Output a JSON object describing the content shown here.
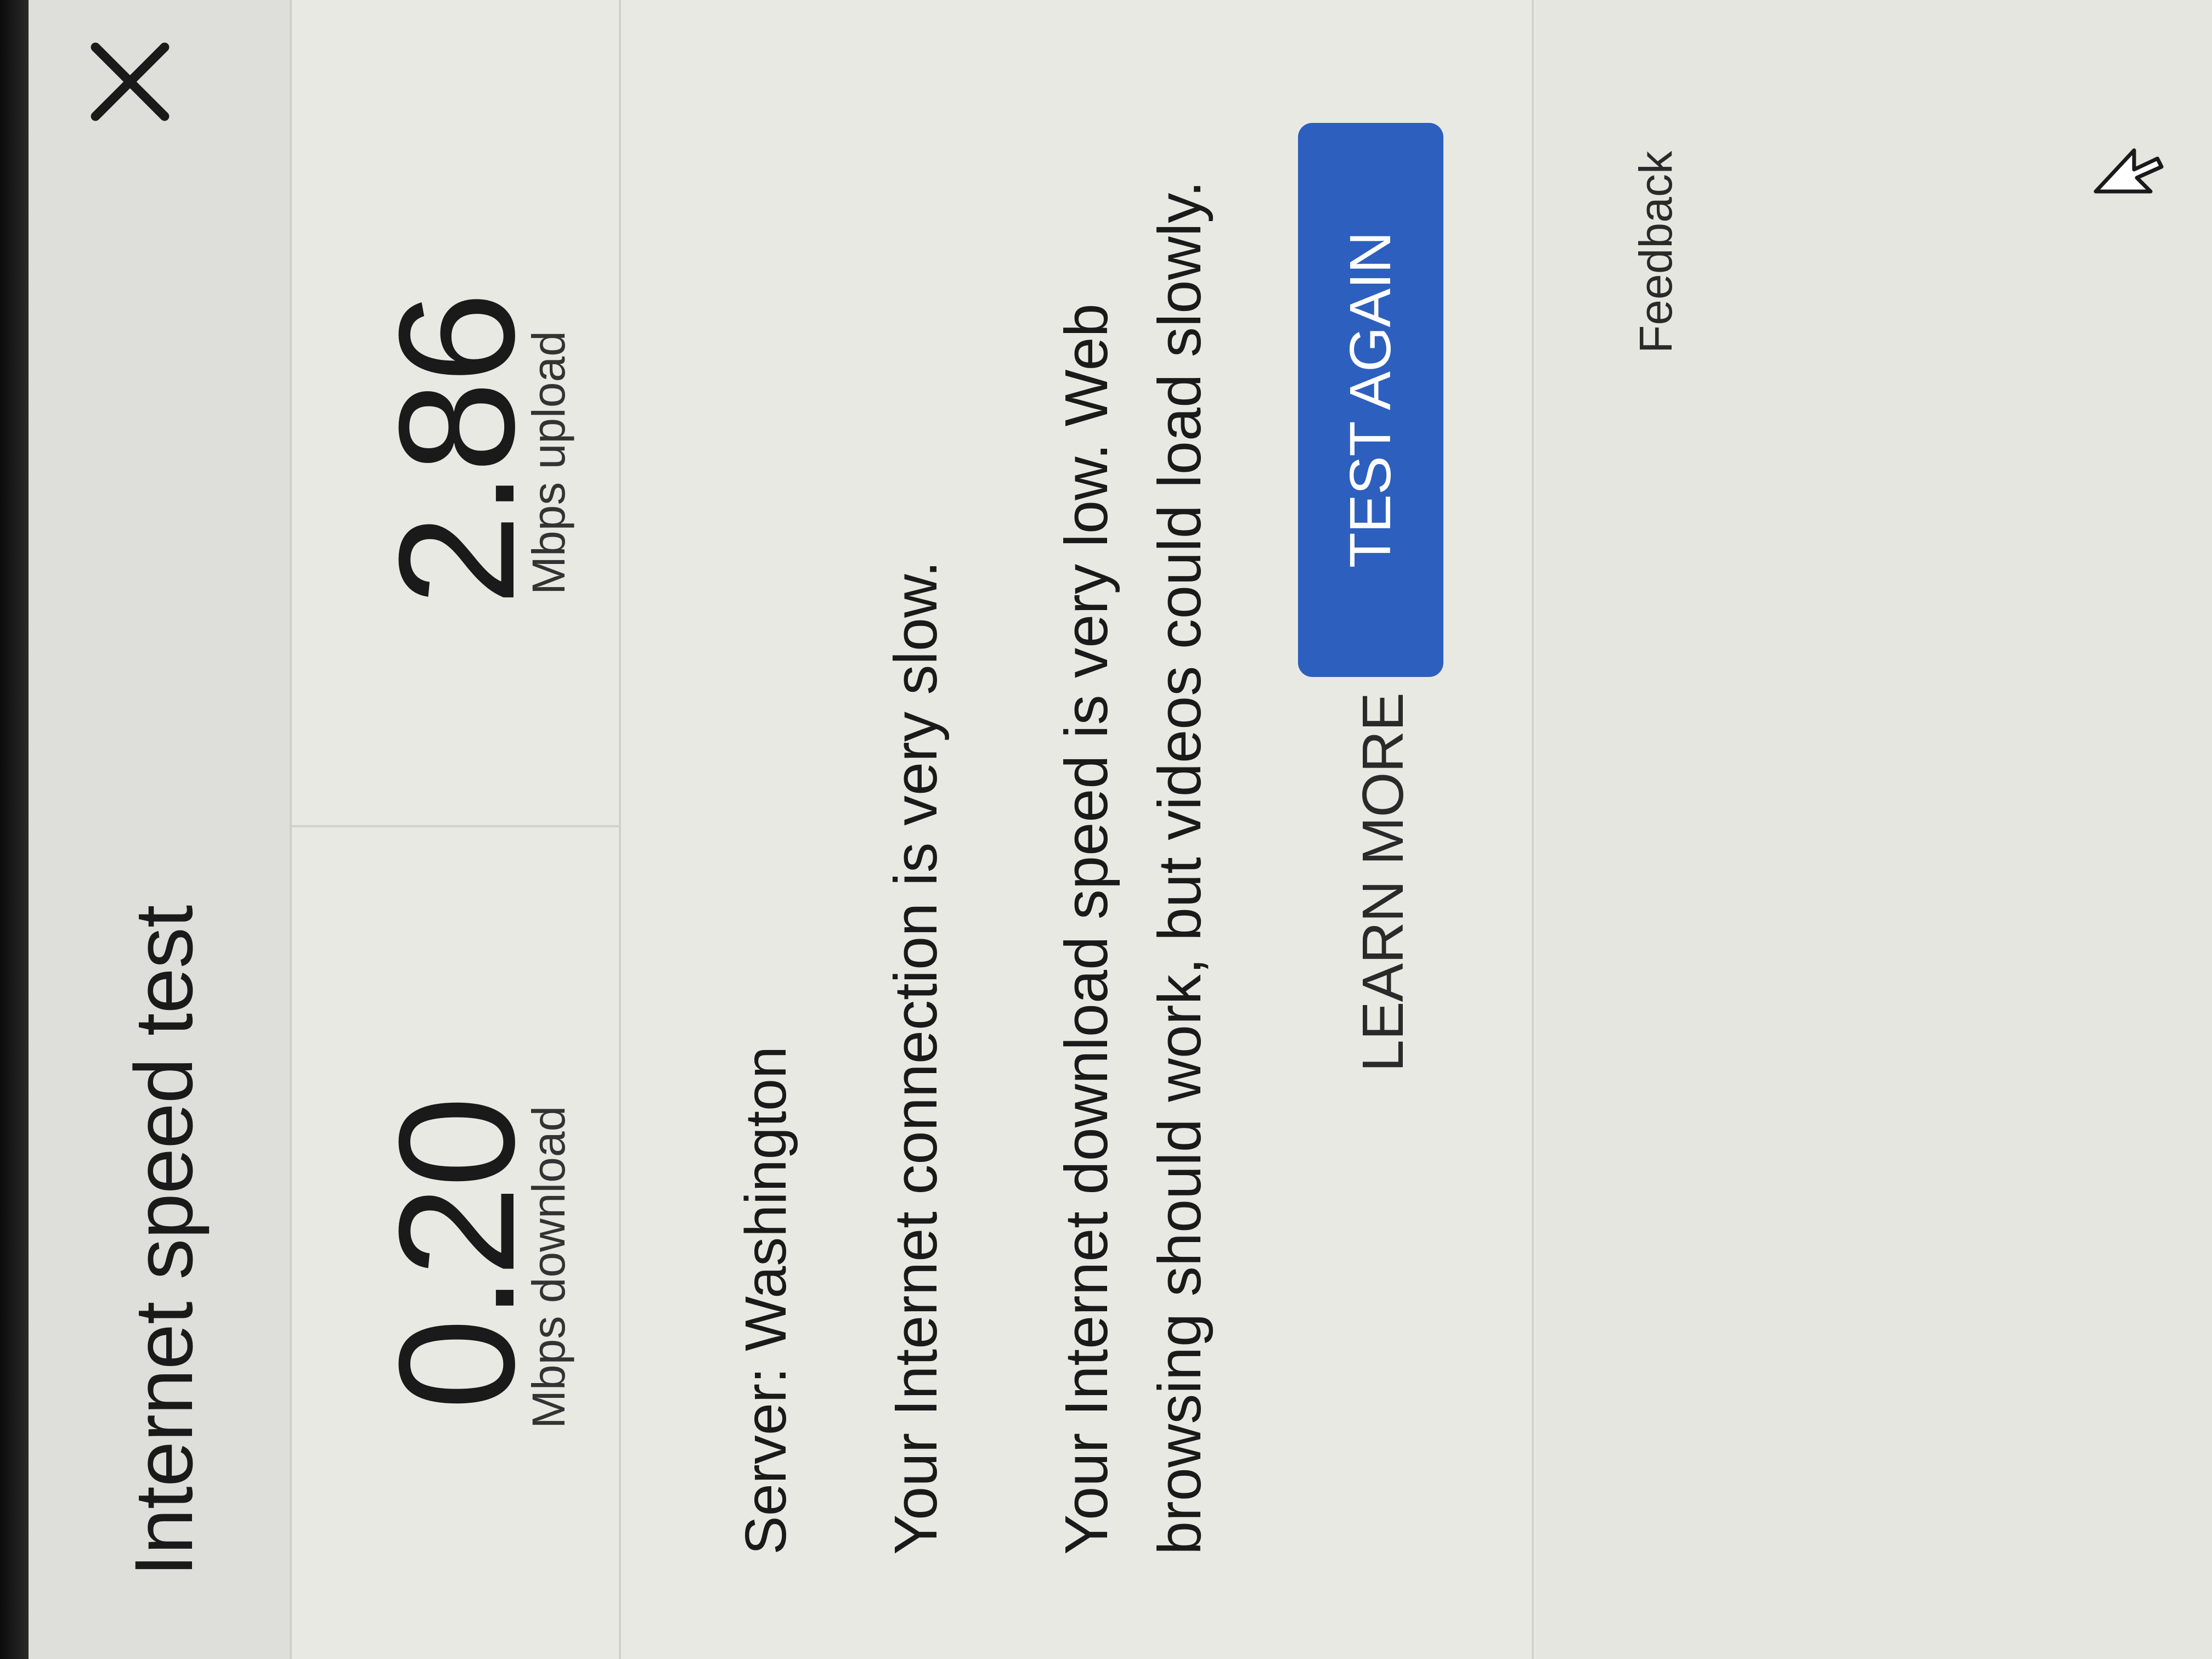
{
  "dialog": {
    "title": "Internet speed test",
    "close_icon": "close-icon"
  },
  "results": {
    "download": {
      "value": "0.20",
      "unit": "Mbps download"
    },
    "upload": {
      "value": "2.86",
      "unit": "Mbps upload"
    }
  },
  "info": {
    "server": "Server: Washington",
    "verdict": "Your Internet connection is very slow.",
    "detail": "Your Internet download speed is very low. Web browsing should work, but videos could load slowly."
  },
  "actions": {
    "learn_more": "LEARN MORE",
    "test_again": "TEST AGAIN"
  },
  "footer": {
    "feedback": "Feedback"
  },
  "colors": {
    "accent": "#2d5fbe",
    "background": "#e9e9e4",
    "header_background": "#dededa",
    "text": "#1a1a1a"
  },
  "icons": {
    "close": "close-icon",
    "pointer": "mouse-pointer-icon"
  }
}
